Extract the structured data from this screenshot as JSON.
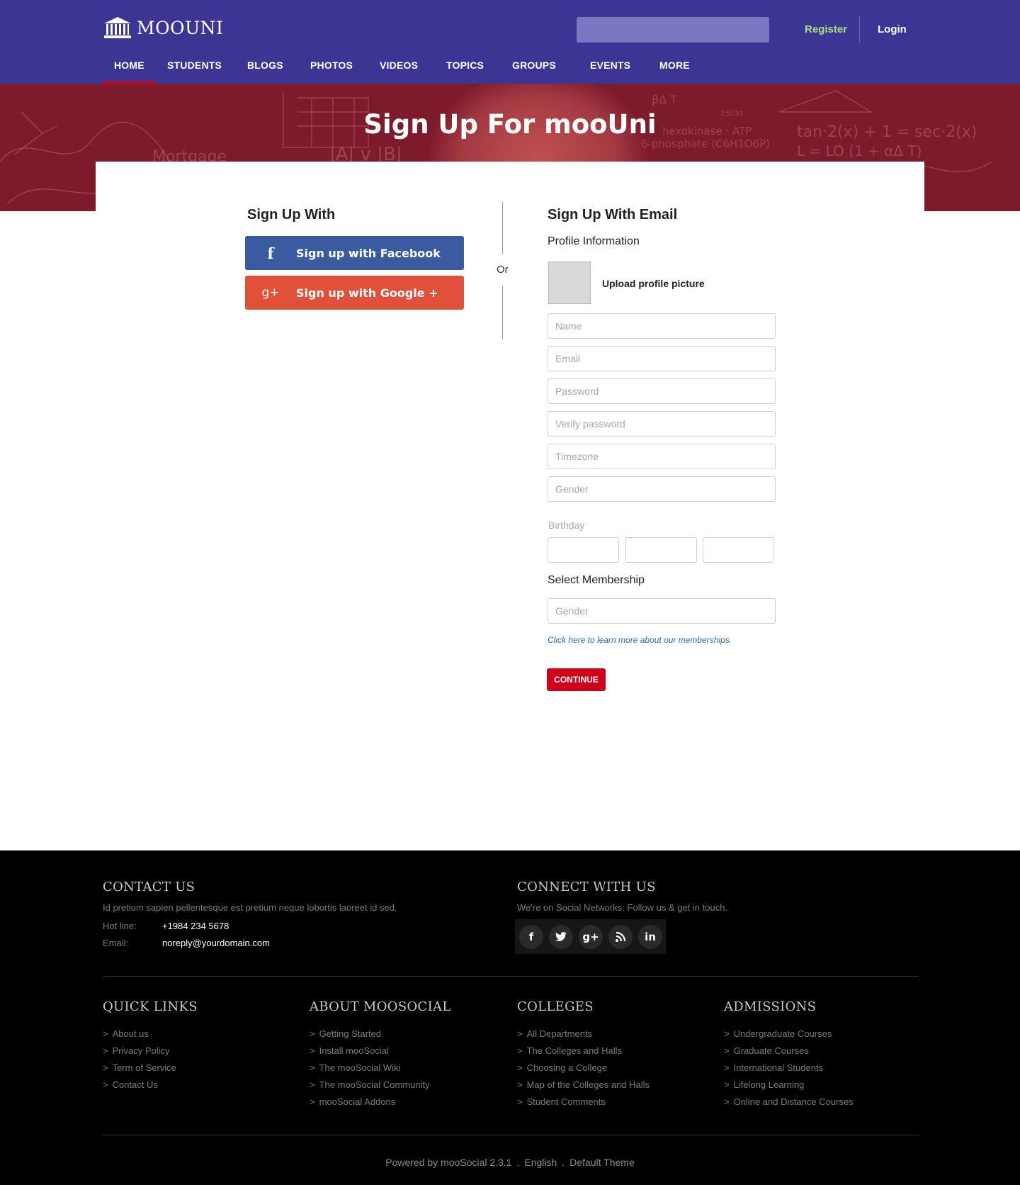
{
  "header": {
    "logo_text": "MOOUNI",
    "search_placeholder": "",
    "register_label": "Register",
    "login_label": "Login"
  },
  "nav": [
    {
      "label": "HOME",
      "active": true
    },
    {
      "label": "STUDENTS"
    },
    {
      "label": "BLOGS"
    },
    {
      "label": "PHOTOS"
    },
    {
      "label": "VIDEOS"
    },
    {
      "label": "TOPICS"
    },
    {
      "label": "GROUPS"
    },
    {
      "label": "EVENTS"
    },
    {
      "label": "MORE"
    }
  ],
  "hero": {
    "title": "Sign Up For mooUni",
    "chalk_texts": [
      "Mortgage",
      "tan·2(x) + 1 = sec·2(x)",
      "L = LO (1 + αΔ T)",
      "hexokinase · ATP",
      "6-phosphate (C6H1O6P)",
      "15CM",
      "βΔ T",
      "|A| v |B|"
    ]
  },
  "signup": {
    "social_title": "Sign Up With",
    "facebook_label": "Sign up with Facebook",
    "google_label": "Sign up with Google +",
    "or_label": "Or",
    "email_title": "Sign Up With Email",
    "profile_info": "Profile Information",
    "upload_label": "Upload profile picture",
    "fields": {
      "name": "Name",
      "email": "Email",
      "password": "Password",
      "verify_password": "Verify password",
      "timezone": "Timezone",
      "gender": "Gender"
    },
    "birthday_label": "Birthday",
    "membership_label": "Select Membership",
    "membership_placeholder": "Gender",
    "membership_link": "Click here to learn more about our memberships.",
    "continue_label": "CONTINUE"
  },
  "footer": {
    "contact": {
      "title": "CONTACT US",
      "description": "Id pretium sapien pellentesque est pretium neque lobortis laoreet id sed.",
      "hotline_label": "Hot line:",
      "hotline_value": "+1984 234 5678",
      "email_label": "Email:",
      "email_value": "noreply@yourdomain.com"
    },
    "connect": {
      "title": "CONNECT WITH US",
      "description": "We're on Social Networks. Follow us & get in touch.",
      "icons": [
        {
          "name": "facebook-icon",
          "glyph": "f"
        },
        {
          "name": "twitter-icon",
          "glyph": "🐦"
        },
        {
          "name": "google-plus-icon",
          "glyph": "g+"
        },
        {
          "name": "rss-icon",
          "glyph": "◉"
        },
        {
          "name": "linkedin-icon",
          "glyph": "in"
        }
      ]
    },
    "columns": {
      "quick_links": {
        "title": "QUICK LINKS",
        "items": [
          "About us",
          "Privacy Policy",
          "Term of Service",
          "Contact Us"
        ]
      },
      "about": {
        "title": "ABOUT MOOSOCIAL",
        "items": [
          "Getting Started",
          "Install mooSocial",
          "The mooSocial Wiki",
          "The mooSocial Community",
          "mooSocial Addons"
        ]
      },
      "colleges": {
        "title": "COLLEGES",
        "items": [
          "All Departments",
          "The Colleges and Halls",
          "Choosing a College",
          "Map of the Colleges and Halls",
          "Student Comments"
        ]
      },
      "admissions": {
        "title": "ADMISSIONS",
        "items": [
          "Undergraduate Courses",
          "Graduate Courses",
          "International Students",
          "Lifelong Learning",
          "Online and Distance Courses"
        ]
      }
    },
    "bottom": {
      "powered": "Powered by mooSocial 2.3.1",
      "dot": ".",
      "language": "English",
      "theme": "Default Theme"
    }
  },
  "colors": {
    "header_bg": "#3b3694",
    "hero_bg": "#7d1a2b",
    "accent_red": "#d0021b",
    "facebook": "#3a5ba0",
    "google": "#e0503a",
    "register_green": "#a6e07a",
    "footer_bg": "#000000"
  }
}
